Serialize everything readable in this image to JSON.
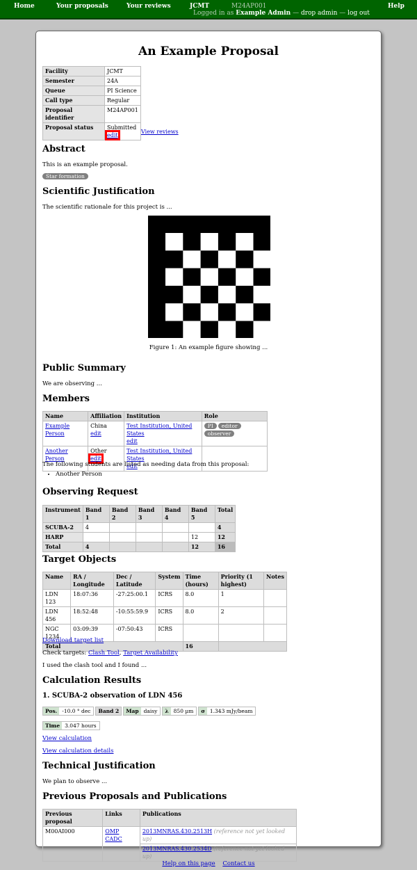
{
  "nav": {
    "home": "Home",
    "proposals": "Your proposals",
    "reviews": "Your reviews",
    "jcmt": "JCMT",
    "proposal_code": "M24AP001",
    "logged_in_as": "Logged in as",
    "user": "Example Admin",
    "sep1": "—",
    "drop_admin": "drop admin",
    "sep2": "—",
    "log_out": "log out",
    "help": "Help"
  },
  "title": "An Example Proposal",
  "info": {
    "rows": [
      {
        "label": "Facility",
        "value": "JCMT"
      },
      {
        "label": "Semester",
        "value": "24A"
      },
      {
        "label": "Queue",
        "value": "PI Science"
      },
      {
        "label": "Call type",
        "value": "Regular"
      },
      {
        "label": "Proposal identifier",
        "value": "M24AP001"
      }
    ],
    "status_label": "Proposal status",
    "status_value": "Submitted",
    "edit": "edit",
    "view_reviews": "View reviews"
  },
  "abstract": {
    "heading": "Abstract",
    "text": "This is an example proposal.",
    "tag": "Star formation"
  },
  "sci": {
    "heading": "Scientific Justification",
    "text": "The scientific rationale for this project is ...",
    "caption": "Figure 1: An example figure showing ..."
  },
  "summary": {
    "heading": "Public Summary",
    "text": "We are observing ..."
  },
  "members": {
    "heading": "Members",
    "columns": [
      "Name",
      "Affiliation",
      "Institution",
      "Role"
    ],
    "rows": [
      {
        "name": "Example Person",
        "affiliation": "China",
        "edit": "edit",
        "institution": "Test Institution, United States",
        "inst_edit": "edit",
        "roles": [
          "PI",
          "editor",
          "observer"
        ]
      },
      {
        "name": "Another Person",
        "affiliation": "Other",
        "edit": "edit",
        "institution": "Test Institution, United States",
        "inst_edit": "edit",
        "roles": []
      }
    ],
    "students_text": "The following students are listed as needing data from this proposal:",
    "students": [
      "Another Person"
    ]
  },
  "request": {
    "heading": "Observing Request",
    "columns": [
      "Instrument",
      "Band 1",
      "Band 2",
      "Band 3",
      "Band 4",
      "Band 5",
      "Total"
    ],
    "rows": [
      {
        "inst": "SCUBA-2",
        "b1": "4",
        "b2": "",
        "b3": "",
        "b4": "",
        "b5": "",
        "total": "4"
      },
      {
        "inst": "HARP",
        "b1": "",
        "b2": "",
        "b3": "",
        "b4": "",
        "b5": "12",
        "total": "12"
      }
    ],
    "totals": {
      "label": "Total",
      "b1": "4",
      "b2": "",
      "b3": "",
      "b4": "",
      "b5": "12",
      "total": "16"
    }
  },
  "targets": {
    "heading": "Target Objects",
    "columns": [
      "Name",
      "RA / Longitude",
      "Dec / Latitude",
      "System",
      "Time (hours)",
      "Priority (1 highest)",
      "Notes"
    ],
    "rows": [
      {
        "name": "LDN 123",
        "ra": "18:07:36",
        "dec": "-27:25:00.1",
        "sys": "ICRS",
        "time": "8.0",
        "prio": "1",
        "notes": ""
      },
      {
        "name": "LDN 456",
        "ra": "18:52:48",
        "dec": "-10:55:59.9",
        "sys": "ICRS",
        "time": "8.0",
        "prio": "2",
        "notes": ""
      },
      {
        "name": "NGC 1234",
        "ra": "03:09:39",
        "dec": "-07:50:43",
        "sys": "ICRS",
        "time": "",
        "prio": "",
        "notes": ""
      }
    ],
    "total_label": "Total",
    "total_time": "16",
    "download": "Download target list",
    "check_prefix": "Check targets:",
    "clash_tool": "Clash Tool",
    "comma": ",",
    "availability": "Target Availability",
    "note": "I used the clash tool and I found ..."
  },
  "calc": {
    "heading": "Calculation Results",
    "item_title": "1. SCUBA-2 observation of LDN 456",
    "pos_label": "Pos.",
    "pos_value": "-10.0 ° dec",
    "band": "Band 2",
    "map_label": "Map",
    "map_value": "daisy",
    "lambda_label": "λ",
    "lambda_value": "850 µm",
    "sigma_label": "σ",
    "sigma_value": "1.343 mJy/beam",
    "time_label": "Time",
    "time_value": "3.047 hours",
    "view_calc": "View calculation",
    "view_details": "View calculation details"
  },
  "tech": {
    "heading": "Technical Justification",
    "text": "We plan to observe ..."
  },
  "prev": {
    "heading": "Previous Proposals and Publications",
    "columns": [
      "Previous proposal",
      "Links",
      "Publications"
    ],
    "code": "M00AI000",
    "omp": "OMP",
    "cadc": "CADC",
    "pubs": [
      {
        "ref": "2013MNRAS.430.2513H",
        "note": "(reference not yet looked up)"
      },
      {
        "ref": "2013MNRAS.430.2534D",
        "note": "(reference not yet looked up)"
      }
    ]
  },
  "footer": {
    "help": "Help on this page",
    "contact": "Contact us"
  }
}
